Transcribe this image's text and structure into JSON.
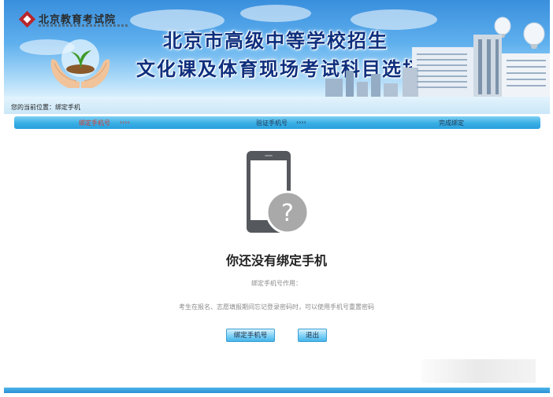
{
  "header": {
    "logo_text": "北京教育考试院",
    "title_line1": "北京市高级中等学校招生",
    "title_line2": "文化课及体育现场考试科目选择"
  },
  "location": {
    "text": "您的当前位置：绑定手机"
  },
  "steps": [
    {
      "label": "绑定手机号",
      "active": true
    },
    {
      "label": "验证手机号",
      "active": false
    },
    {
      "label": "完成绑定",
      "active": false
    }
  ],
  "step_arrow": "››››",
  "colors": {
    "title": "#0e2f7d",
    "active_step": "#d63a2c",
    "step_bar": "#38aee5",
    "phone_icon": "#55585c",
    "question_badge": "#a9a9a9"
  },
  "main": {
    "phone_icon": "phone-question-icon",
    "heading": "你还没有绑定手机",
    "note_label": "绑定手机号作用：",
    "note_text": "考生在报名、志愿填报期间忘记登录密码时，可以使用手机号重置密码"
  },
  "buttons": {
    "bind": "绑定手机号",
    "exit": "退出"
  }
}
